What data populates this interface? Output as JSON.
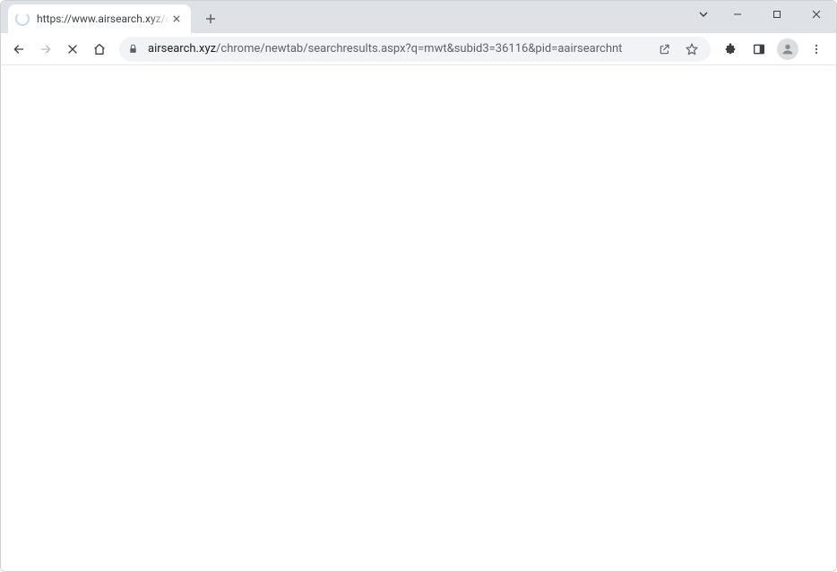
{
  "tab": {
    "title": "https://www.airsearch.xyz/chrome/newtab/searchresults.aspx"
  },
  "url": {
    "host": "airsearch.xyz",
    "path": "/chrome/newtab/searchresults.aspx?q=mwt&subid3=36116&pid=aairsearchnt"
  },
  "colors": {
    "tabstrip": "#dee1e6",
    "omnibox": "#f1f3f4",
    "icon": "#5f6368",
    "icon_dark": "#3c4043"
  }
}
